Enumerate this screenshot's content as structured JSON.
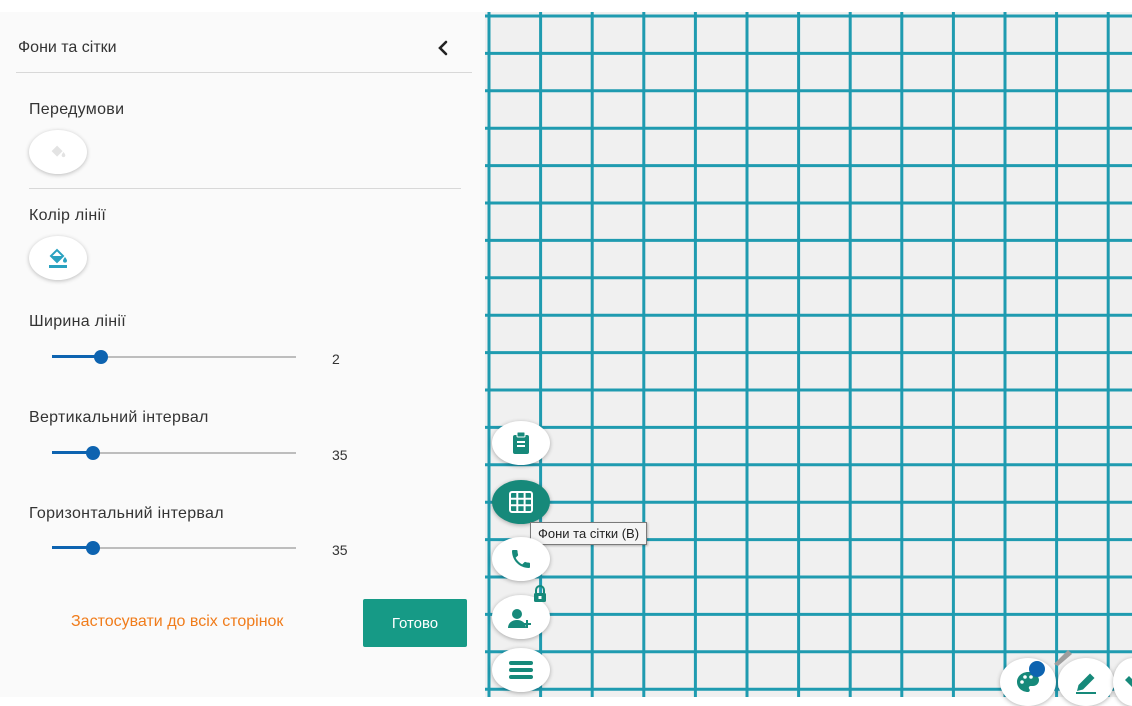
{
  "panel": {
    "title": "Фони та сітки",
    "back_icon": "chevron-left-icon",
    "backgrounds": {
      "label": "Передумови",
      "icon": "paint-bucket-icon"
    },
    "line_color": {
      "label": "Колір лінії",
      "icon": "paint-bucket-underline-icon",
      "color": "#2aa2c0"
    },
    "line_width": {
      "label": "Ширина лінії",
      "value": "2",
      "fraction": 0.2
    },
    "vertical_interval": {
      "label": "Вертикальний інтервал",
      "value": "35",
      "fraction": 0.17
    },
    "horizontal_interval": {
      "label": "Горизонтальний інтервал",
      "value": "35",
      "fraction": 0.17
    },
    "apply_all_label": "Застосувати до всіх сторінок",
    "done_label": "Готово"
  },
  "canvas": {
    "background": "#f0f0f0",
    "grid_color": "#1f9bb0"
  },
  "tools": [
    {
      "name": "notes",
      "icon": "clipboard-icon"
    },
    {
      "name": "backgrounds-grids",
      "icon": "grid-icon",
      "active": true
    },
    {
      "name": "call",
      "icon": "phone-icon"
    },
    {
      "name": "add-user",
      "icon": "add-user-lock-icon"
    },
    {
      "name": "menu",
      "icon": "menu-icon"
    }
  ],
  "tooltip": {
    "text": "Фони та сітки (B)"
  },
  "colors": {
    "accent": "#169a86",
    "slider": "#0d63b0",
    "link": "#f07c1b"
  }
}
